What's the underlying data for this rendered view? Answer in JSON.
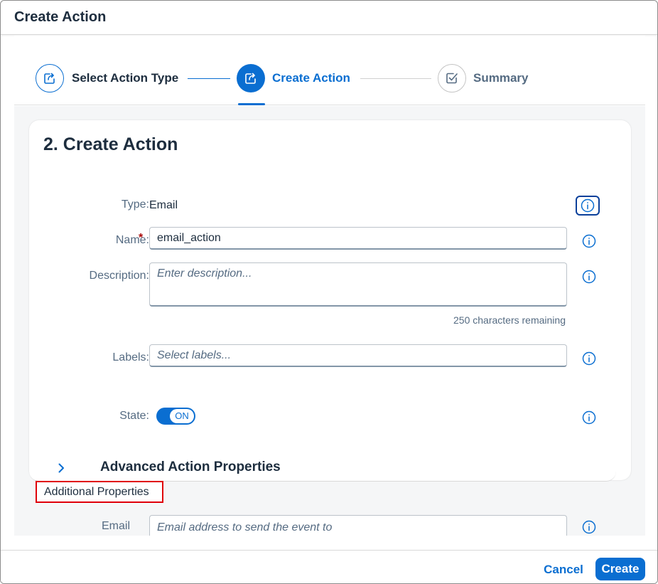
{
  "dialog": {
    "title": "Create Action"
  },
  "wizard": {
    "steps": [
      {
        "label": "Select Action Type",
        "icon": "share-icon",
        "state": "completed"
      },
      {
        "label": "Create Action",
        "icon": "share-icon",
        "state": "active"
      },
      {
        "label": "Summary",
        "icon": "checkbox-icon",
        "state": "pending"
      }
    ]
  },
  "form": {
    "title": "2. Create Action",
    "type": {
      "label": "Type:",
      "value": "Email"
    },
    "name": {
      "label": "Name:",
      "required_mark": "*",
      "value": "email_action"
    },
    "description": {
      "label": "Description:",
      "placeholder": "Enter description...",
      "counter": "250 characters remaining"
    },
    "labels": {
      "label": "Labels:",
      "placeholder": "Select labels..."
    },
    "state": {
      "label": "State:",
      "toggle_text": "ON",
      "on": true
    },
    "advanced": {
      "title": "Advanced Action Properties"
    },
    "additional": {
      "title": "Additional Properties"
    },
    "email": {
      "label": "Email",
      "placeholder": "Email address to send the event to"
    }
  },
  "footer": {
    "cancel_label": "Cancel",
    "create_label": "Create"
  },
  "colors": {
    "accent": "#0a6ed1",
    "highlight_box": "#e0000a",
    "text": "#1d2d3e",
    "label": "#556b82"
  }
}
